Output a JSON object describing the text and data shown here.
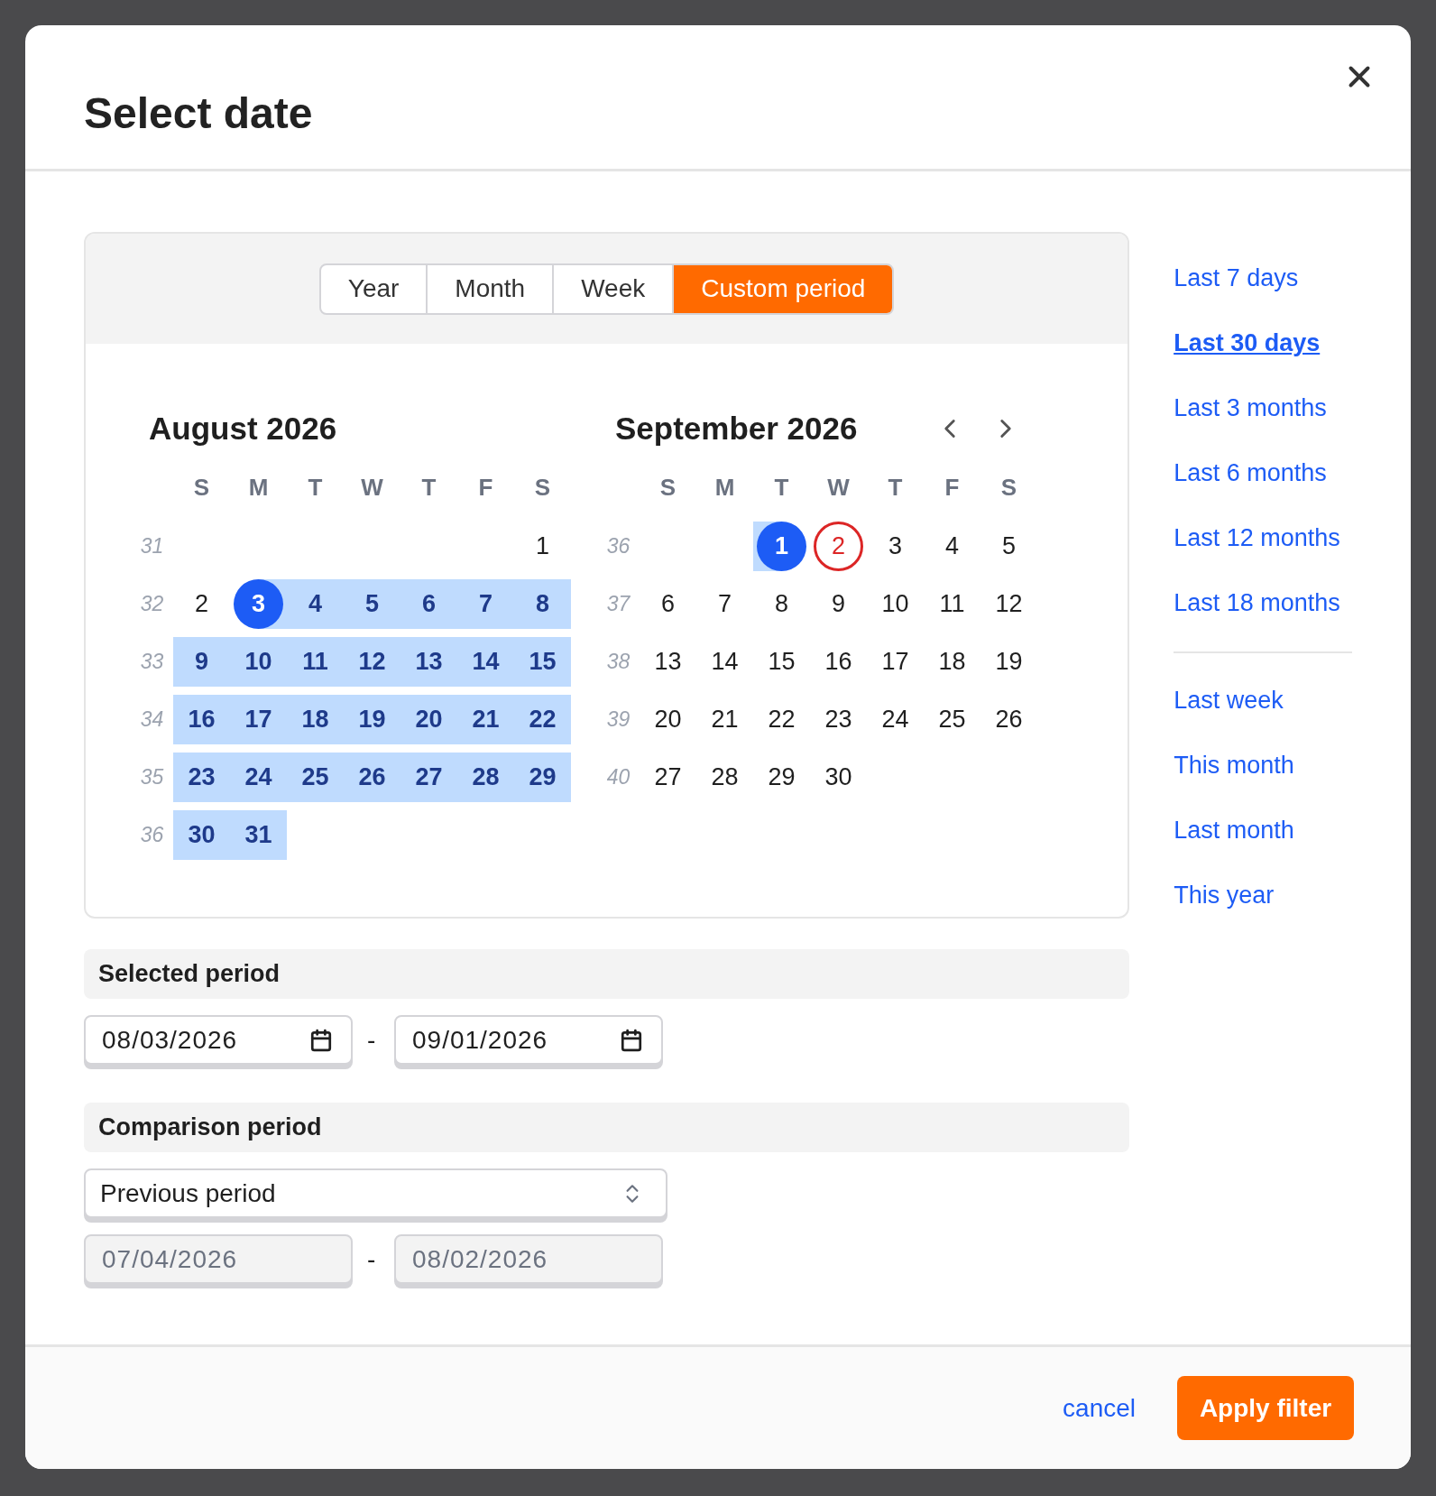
{
  "dialog": {
    "title": "Select date"
  },
  "view_tabs": [
    {
      "label": "Year",
      "selected": false
    },
    {
      "label": "Month",
      "selected": false
    },
    {
      "label": "Week",
      "selected": false
    },
    {
      "label": "Custom period",
      "selected": true
    }
  ],
  "months": [
    {
      "title": "August 2026",
      "weekdays": [
        "S",
        "M",
        "T",
        "W",
        "T",
        "F",
        "S"
      ],
      "weeks": [
        {
          "number": "31",
          "days": [
            {
              "kind": "empty"
            },
            {
              "kind": "empty"
            },
            {
              "kind": "empty"
            },
            {
              "kind": "empty"
            },
            {
              "kind": "empty"
            },
            {
              "kind": "empty"
            },
            {
              "kind": "plain",
              "label": "1"
            }
          ]
        },
        {
          "number": "32",
          "days": [
            {
              "kind": "plain",
              "label": "2"
            },
            {
              "kind": "range_start",
              "label": "3"
            },
            {
              "kind": "in_range",
              "label": "4"
            },
            {
              "kind": "in_range",
              "label": "5"
            },
            {
              "kind": "in_range",
              "label": "6"
            },
            {
              "kind": "in_range",
              "label": "7"
            },
            {
              "kind": "in_range",
              "label": "8"
            }
          ]
        },
        {
          "number": "33",
          "days": [
            {
              "kind": "in_range",
              "label": "9"
            },
            {
              "kind": "in_range",
              "label": "10"
            },
            {
              "kind": "in_range",
              "label": "11"
            },
            {
              "kind": "in_range",
              "label": "12"
            },
            {
              "kind": "in_range",
              "label": "13"
            },
            {
              "kind": "in_range",
              "label": "14"
            },
            {
              "kind": "in_range",
              "label": "15"
            }
          ]
        },
        {
          "number": "34",
          "days": [
            {
              "kind": "in_range",
              "label": "16"
            },
            {
              "kind": "in_range",
              "label": "17"
            },
            {
              "kind": "in_range",
              "label": "18"
            },
            {
              "kind": "in_range",
              "label": "19"
            },
            {
              "kind": "in_range",
              "label": "20"
            },
            {
              "kind": "in_range",
              "label": "21"
            },
            {
              "kind": "in_range",
              "label": "22"
            }
          ]
        },
        {
          "number": "35",
          "days": [
            {
              "kind": "in_range",
              "label": "23"
            },
            {
              "kind": "in_range",
              "label": "24"
            },
            {
              "kind": "in_range",
              "label": "25"
            },
            {
              "kind": "in_range",
              "label": "26"
            },
            {
              "kind": "in_range",
              "label": "27"
            },
            {
              "kind": "in_range",
              "label": "28"
            },
            {
              "kind": "in_range",
              "label": "29"
            }
          ]
        },
        {
          "number": "36",
          "days": [
            {
              "kind": "in_range",
              "label": "30"
            },
            {
              "kind": "in_range",
              "label": "31"
            },
            {
              "kind": "empty"
            },
            {
              "kind": "empty"
            },
            {
              "kind": "empty"
            },
            {
              "kind": "empty"
            },
            {
              "kind": "empty"
            }
          ]
        }
      ]
    },
    {
      "title": "September 2026",
      "nav": true,
      "weekdays": [
        "S",
        "M",
        "T",
        "W",
        "T",
        "F",
        "S"
      ],
      "weeks": [
        {
          "number": "36",
          "days": [
            {
              "kind": "empty"
            },
            {
              "kind": "empty"
            },
            {
              "kind": "range_end",
              "label": "1"
            },
            {
              "kind": "today",
              "label": "2"
            },
            {
              "kind": "plain",
              "label": "3"
            },
            {
              "kind": "plain",
              "label": "4"
            },
            {
              "kind": "plain",
              "label": "5"
            }
          ]
        },
        {
          "number": "37",
          "days": [
            {
              "kind": "plain",
              "label": "6"
            },
            {
              "kind": "plain",
              "label": "7"
            },
            {
              "kind": "plain",
              "label": "8"
            },
            {
              "kind": "plain",
              "label": "9"
            },
            {
              "kind": "plain",
              "label": "10"
            },
            {
              "kind": "plain",
              "label": "11"
            },
            {
              "kind": "plain",
              "label": "12"
            }
          ]
        },
        {
          "number": "38",
          "days": [
            {
              "kind": "plain",
              "label": "13"
            },
            {
              "kind": "plain",
              "label": "14"
            },
            {
              "kind": "plain",
              "label": "15"
            },
            {
              "kind": "plain",
              "label": "16"
            },
            {
              "kind": "plain",
              "label": "17"
            },
            {
              "kind": "plain",
              "label": "18"
            },
            {
              "kind": "plain",
              "label": "19"
            }
          ]
        },
        {
          "number": "39",
          "days": [
            {
              "kind": "plain",
              "label": "20"
            },
            {
              "kind": "plain",
              "label": "21"
            },
            {
              "kind": "plain",
              "label": "22"
            },
            {
              "kind": "plain",
              "label": "23"
            },
            {
              "kind": "plain",
              "label": "24"
            },
            {
              "kind": "plain",
              "label": "25"
            },
            {
              "kind": "plain",
              "label": "26"
            }
          ]
        },
        {
          "number": "40",
          "days": [
            {
              "kind": "plain",
              "label": "27"
            },
            {
              "kind": "plain",
              "label": "28"
            },
            {
              "kind": "plain",
              "label": "29"
            },
            {
              "kind": "plain",
              "label": "30"
            },
            {
              "kind": "empty"
            },
            {
              "kind": "empty"
            },
            {
              "kind": "empty"
            }
          ]
        }
      ]
    }
  ],
  "selected_period": {
    "heading": "Selected period",
    "separator": "-",
    "fields": [
      {
        "value": "08/03/2026",
        "disabled": false
      },
      {
        "value": "09/01/2026",
        "disabled": false
      }
    ]
  },
  "comparison_period": {
    "heading": "Comparison period",
    "select": {
      "value": "Previous period"
    },
    "separator": "-",
    "fields": [
      {
        "value": "07/04/2026",
        "disabled": true
      },
      {
        "value": "08/02/2026",
        "disabled": true
      }
    ]
  },
  "preset_groups": [
    {
      "items": [
        {
          "label": "Last 7 days",
          "selected": false
        },
        {
          "label": "Last 30 days",
          "selected": true
        },
        {
          "label": "Last 3 months",
          "selected": false
        },
        {
          "label": "Last 6 months",
          "selected": false
        },
        {
          "label": "Last 12 months",
          "selected": false
        },
        {
          "label": "Last 18 months",
          "selected": false
        }
      ]
    },
    {
      "items": [
        {
          "label": "Last week",
          "selected": false
        },
        {
          "label": "This month",
          "selected": false
        },
        {
          "label": "Last month",
          "selected": false
        },
        {
          "label": "This year",
          "selected": false
        }
      ]
    }
  ],
  "footer": {
    "cancel": "cancel",
    "apply": "Apply filter"
  }
}
